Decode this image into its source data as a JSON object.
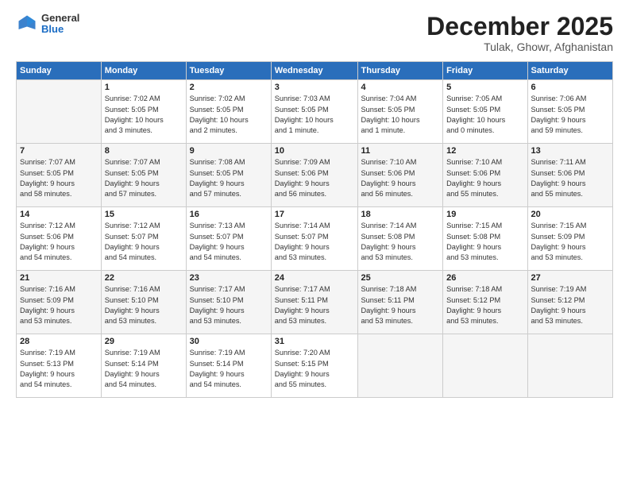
{
  "header": {
    "logo_general": "General",
    "logo_blue": "Blue",
    "title": "December 2025",
    "subtitle": "Tulak, Ghowr, Afghanistan"
  },
  "days_of_week": [
    "Sunday",
    "Monday",
    "Tuesday",
    "Wednesday",
    "Thursday",
    "Friday",
    "Saturday"
  ],
  "weeks": [
    [
      {
        "day": "",
        "info": ""
      },
      {
        "day": "1",
        "info": "Sunrise: 7:02 AM\nSunset: 5:05 PM\nDaylight: 10 hours\nand 3 minutes."
      },
      {
        "day": "2",
        "info": "Sunrise: 7:02 AM\nSunset: 5:05 PM\nDaylight: 10 hours\nand 2 minutes."
      },
      {
        "day": "3",
        "info": "Sunrise: 7:03 AM\nSunset: 5:05 PM\nDaylight: 10 hours\nand 1 minute."
      },
      {
        "day": "4",
        "info": "Sunrise: 7:04 AM\nSunset: 5:05 PM\nDaylight: 10 hours\nand 1 minute."
      },
      {
        "day": "5",
        "info": "Sunrise: 7:05 AM\nSunset: 5:05 PM\nDaylight: 10 hours\nand 0 minutes."
      },
      {
        "day": "6",
        "info": "Sunrise: 7:06 AM\nSunset: 5:05 PM\nDaylight: 9 hours\nand 59 minutes."
      }
    ],
    [
      {
        "day": "7",
        "info": "Sunrise: 7:07 AM\nSunset: 5:05 PM\nDaylight: 9 hours\nand 58 minutes."
      },
      {
        "day": "8",
        "info": "Sunrise: 7:07 AM\nSunset: 5:05 PM\nDaylight: 9 hours\nand 57 minutes."
      },
      {
        "day": "9",
        "info": "Sunrise: 7:08 AM\nSunset: 5:05 PM\nDaylight: 9 hours\nand 57 minutes."
      },
      {
        "day": "10",
        "info": "Sunrise: 7:09 AM\nSunset: 5:06 PM\nDaylight: 9 hours\nand 56 minutes."
      },
      {
        "day": "11",
        "info": "Sunrise: 7:10 AM\nSunset: 5:06 PM\nDaylight: 9 hours\nand 56 minutes."
      },
      {
        "day": "12",
        "info": "Sunrise: 7:10 AM\nSunset: 5:06 PM\nDaylight: 9 hours\nand 55 minutes."
      },
      {
        "day": "13",
        "info": "Sunrise: 7:11 AM\nSunset: 5:06 PM\nDaylight: 9 hours\nand 55 minutes."
      }
    ],
    [
      {
        "day": "14",
        "info": "Sunrise: 7:12 AM\nSunset: 5:06 PM\nDaylight: 9 hours\nand 54 minutes."
      },
      {
        "day": "15",
        "info": "Sunrise: 7:12 AM\nSunset: 5:07 PM\nDaylight: 9 hours\nand 54 minutes."
      },
      {
        "day": "16",
        "info": "Sunrise: 7:13 AM\nSunset: 5:07 PM\nDaylight: 9 hours\nand 54 minutes."
      },
      {
        "day": "17",
        "info": "Sunrise: 7:14 AM\nSunset: 5:07 PM\nDaylight: 9 hours\nand 53 minutes."
      },
      {
        "day": "18",
        "info": "Sunrise: 7:14 AM\nSunset: 5:08 PM\nDaylight: 9 hours\nand 53 minutes."
      },
      {
        "day": "19",
        "info": "Sunrise: 7:15 AM\nSunset: 5:08 PM\nDaylight: 9 hours\nand 53 minutes."
      },
      {
        "day": "20",
        "info": "Sunrise: 7:15 AM\nSunset: 5:09 PM\nDaylight: 9 hours\nand 53 minutes."
      }
    ],
    [
      {
        "day": "21",
        "info": "Sunrise: 7:16 AM\nSunset: 5:09 PM\nDaylight: 9 hours\nand 53 minutes."
      },
      {
        "day": "22",
        "info": "Sunrise: 7:16 AM\nSunset: 5:10 PM\nDaylight: 9 hours\nand 53 minutes."
      },
      {
        "day": "23",
        "info": "Sunrise: 7:17 AM\nSunset: 5:10 PM\nDaylight: 9 hours\nand 53 minutes."
      },
      {
        "day": "24",
        "info": "Sunrise: 7:17 AM\nSunset: 5:11 PM\nDaylight: 9 hours\nand 53 minutes."
      },
      {
        "day": "25",
        "info": "Sunrise: 7:18 AM\nSunset: 5:11 PM\nDaylight: 9 hours\nand 53 minutes."
      },
      {
        "day": "26",
        "info": "Sunrise: 7:18 AM\nSunset: 5:12 PM\nDaylight: 9 hours\nand 53 minutes."
      },
      {
        "day": "27",
        "info": "Sunrise: 7:19 AM\nSunset: 5:12 PM\nDaylight: 9 hours\nand 53 minutes."
      }
    ],
    [
      {
        "day": "28",
        "info": "Sunrise: 7:19 AM\nSunset: 5:13 PM\nDaylight: 9 hours\nand 54 minutes."
      },
      {
        "day": "29",
        "info": "Sunrise: 7:19 AM\nSunset: 5:14 PM\nDaylight: 9 hours\nand 54 minutes."
      },
      {
        "day": "30",
        "info": "Sunrise: 7:19 AM\nSunset: 5:14 PM\nDaylight: 9 hours\nand 54 minutes."
      },
      {
        "day": "31",
        "info": "Sunrise: 7:20 AM\nSunset: 5:15 PM\nDaylight: 9 hours\nand 55 minutes."
      },
      {
        "day": "",
        "info": ""
      },
      {
        "day": "",
        "info": ""
      },
      {
        "day": "",
        "info": ""
      }
    ]
  ]
}
